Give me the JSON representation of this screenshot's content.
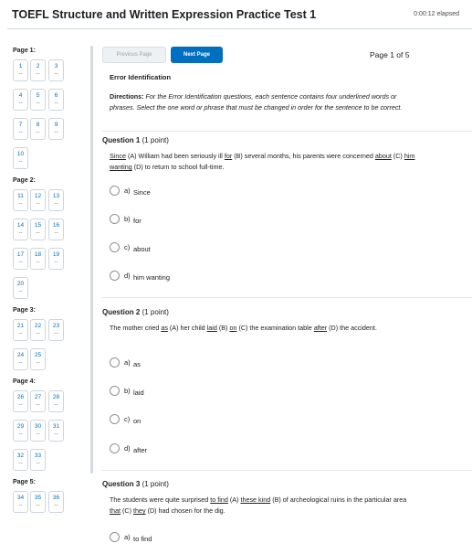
{
  "header": {
    "title": "TOEFL Structure and Written Expression Practice Test 1",
    "timer": "0:00:12 elapsed"
  },
  "sidebar": {
    "pages": [
      {
        "label": "Page 1:",
        "questions": [
          {
            "num": "1",
            "status": "--"
          },
          {
            "num": "2",
            "status": "--"
          },
          {
            "num": "3",
            "status": "--"
          },
          {
            "num": "4",
            "status": "--"
          },
          {
            "num": "5",
            "status": "--"
          },
          {
            "num": "6",
            "status": "--"
          },
          {
            "num": "7",
            "status": "--"
          },
          {
            "num": "8",
            "status": "--"
          },
          {
            "num": "9",
            "status": "--"
          },
          {
            "num": "10",
            "status": "--"
          }
        ]
      },
      {
        "label": "Page 2:",
        "questions": [
          {
            "num": "11",
            "status": "--"
          },
          {
            "num": "12",
            "status": "--"
          },
          {
            "num": "13",
            "status": "--"
          },
          {
            "num": "14",
            "status": "--"
          },
          {
            "num": "15",
            "status": "--"
          },
          {
            "num": "16",
            "status": "--"
          },
          {
            "num": "17",
            "status": "--"
          },
          {
            "num": "18",
            "status": "--"
          },
          {
            "num": "19",
            "status": "--"
          },
          {
            "num": "20",
            "status": "--"
          }
        ]
      },
      {
        "label": "Page 3:",
        "questions": [
          {
            "num": "21",
            "status": "--"
          },
          {
            "num": "22",
            "status": "--"
          },
          {
            "num": "23",
            "status": "--"
          },
          {
            "num": "24",
            "status": "--"
          },
          {
            "num": "25",
            "status": "--"
          }
        ]
      },
      {
        "label": "Page 4:",
        "questions": [
          {
            "num": "26",
            "status": "--"
          },
          {
            "num": "27",
            "status": "--"
          },
          {
            "num": "28",
            "status": "--"
          },
          {
            "num": "29",
            "status": "--"
          },
          {
            "num": "30",
            "status": "--"
          },
          {
            "num": "31",
            "status": "--"
          },
          {
            "num": "32",
            "status": "--"
          },
          {
            "num": "33",
            "status": "--"
          }
        ]
      },
      {
        "label": "Page 5:",
        "questions": [
          {
            "num": "34",
            "status": "--"
          },
          {
            "num": "35",
            "status": "--"
          },
          {
            "num": "36",
            "status": "--"
          }
        ]
      }
    ]
  },
  "nav": {
    "prev_label": "Previous Page",
    "next_label": "Next Page",
    "page_indicator": "Page 1 of 5"
  },
  "section": {
    "title": "Error Identification",
    "directions_label": "Directions:",
    "directions_text": "For the Error Identification questions, each sentence contains four underlined words or phrases. Select the one word or phrase that must be changed in order for the sentence to be correct."
  },
  "questions": [
    {
      "title": "Question 1",
      "points": "(1 point)",
      "text_parts": [
        {
          "t": "Since",
          "u": true
        },
        {
          "t": " (A) William had been seriously ill ",
          "u": false
        },
        {
          "t": "for",
          "u": true
        },
        {
          "t": " (B) several months, his parents were concerned ",
          "u": false
        },
        {
          "t": "about",
          "u": true
        },
        {
          "t": " (C) ",
          "u": false
        },
        {
          "t": "him wanting",
          "u": true
        },
        {
          "t": " (D) to return to school full-time.",
          "u": false
        }
      ],
      "options": [
        {
          "letter": "a)",
          "text": "Since"
        },
        {
          "letter": "b)",
          "text": "for"
        },
        {
          "letter": "c)",
          "text": "about"
        },
        {
          "letter": "d)",
          "text": "him wanting"
        }
      ]
    },
    {
      "title": "Question 2",
      "points": "(1 point)",
      "text_parts": [
        {
          "t": "The mother cried ",
          "u": false
        },
        {
          "t": "as",
          "u": true
        },
        {
          "t": " (A) her child ",
          "u": false
        },
        {
          "t": "laid",
          "u": true
        },
        {
          "t": " (B) ",
          "u": false
        },
        {
          "t": "on",
          "u": true
        },
        {
          "t": " (C) the examination table ",
          "u": false
        },
        {
          "t": "after",
          "u": true
        },
        {
          "t": " (D) the accident.",
          "u": false
        }
      ],
      "options": [
        {
          "letter": "a)",
          "text": "as"
        },
        {
          "letter": "b)",
          "text": "laid"
        },
        {
          "letter": "c)",
          "text": "on"
        },
        {
          "letter": "d)",
          "text": "after"
        }
      ]
    },
    {
      "title": "Question 3",
      "points": "(1 point)",
      "text_parts": [
        {
          "t": "The students were quite surprised ",
          "u": false
        },
        {
          "t": "to find",
          "u": true
        },
        {
          "t": " (A) ",
          "u": false
        },
        {
          "t": "these kind",
          "u": true
        },
        {
          "t": " (B) of archeological ruins in the particular area ",
          "u": false
        },
        {
          "t": "that",
          "u": true
        },
        {
          "t": " (C) ",
          "u": false
        },
        {
          "t": "they",
          "u": true
        },
        {
          "t": " (D) had chosen for the dig.",
          "u": false
        }
      ],
      "options": [
        {
          "letter": "a)",
          "text": "to find"
        }
      ]
    }
  ],
  "colors": {
    "accent": "#006fbf",
    "link": "#006fbf",
    "border": "#cdd5dc",
    "text": "#202122"
  }
}
